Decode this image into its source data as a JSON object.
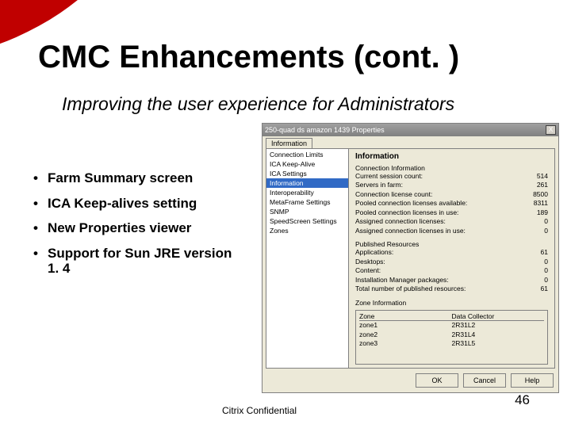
{
  "slide": {
    "title": "CMC Enhancements (cont. )",
    "subtitle": "Improving the user experience for Administrators",
    "bullets": [
      "Farm Summary screen",
      "ICA Keep-alives setting",
      "New Properties viewer",
      "Support for Sun JRE version 1. 4"
    ],
    "footer": "Citrix Confidential",
    "page": "46"
  },
  "dialog": {
    "title": "250-quad ds amazon 1439 Properties",
    "close": "X",
    "tab": "Information",
    "sidebar": {
      "items": [
        "Connection Limits",
        "ICA Keep-Alive",
        "ICA Settings",
        "Information",
        "Interoperability",
        "MetaFrame Settings",
        "SNMP",
        "SpeedScreen Settings",
        "Zones"
      ],
      "selected": 3
    },
    "panel": {
      "heading": "Information",
      "conn": {
        "title": "Connection Information",
        "rows": [
          {
            "label": "Current session count:",
            "value": "514"
          },
          {
            "label": "Servers in farm:",
            "value": "261"
          },
          {
            "label": "Connection license count:",
            "value": "8500"
          },
          {
            "label": "Pooled connection licenses available:",
            "value": "8311"
          },
          {
            "label": "Pooled connection licenses in use:",
            "value": "189"
          },
          {
            "label": "Assigned connection licenses:",
            "value": "0"
          },
          {
            "label": "Assigned connection licenses in use:",
            "value": "0"
          }
        ]
      },
      "pub": {
        "title": "Published Resources",
        "rows": [
          {
            "label": "Applications:",
            "value": "61"
          },
          {
            "label": "Desktops:",
            "value": "0"
          },
          {
            "label": "Content:",
            "value": "0"
          },
          {
            "label": "Installation Manager packages:",
            "value": "0"
          },
          {
            "label": "Total number of published resources:",
            "value": "61"
          }
        ]
      },
      "zone": {
        "title": "Zone Information",
        "col1": "Zone",
        "col2": "Data Collector",
        "rows": [
          {
            "zone": "zone1",
            "dc": "2R31L2"
          },
          {
            "zone": "zone2",
            "dc": "2R31L4"
          },
          {
            "zone": "zone3",
            "dc": "2R31L5"
          }
        ]
      }
    },
    "buttons": {
      "ok": "OK",
      "cancel": "Cancel",
      "help": "Help"
    }
  }
}
